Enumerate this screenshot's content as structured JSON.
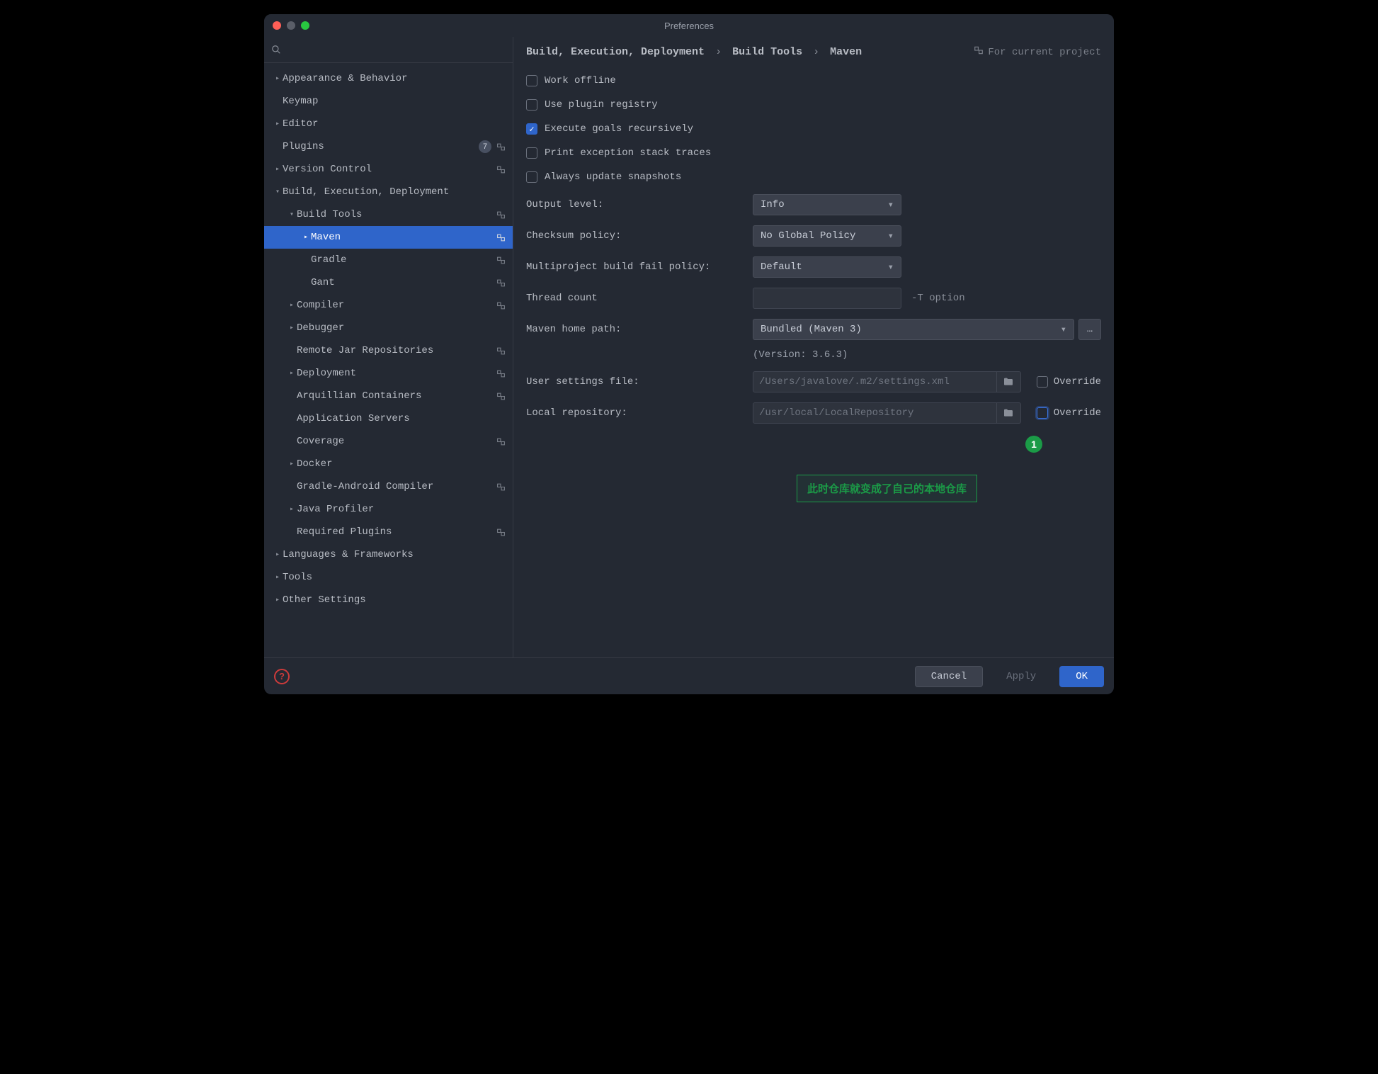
{
  "window": {
    "title": "Preferences"
  },
  "search": {
    "placeholder": ""
  },
  "sidebar": {
    "items": [
      {
        "label": "Appearance & Behavior",
        "indent": 0,
        "arrow": ">",
        "pin": false
      },
      {
        "label": "Keymap",
        "indent": 0,
        "arrow": "",
        "pin": false
      },
      {
        "label": "Editor",
        "indent": 0,
        "arrow": ">",
        "pin": false
      },
      {
        "label": "Plugins",
        "indent": 0,
        "arrow": "",
        "pin": true,
        "badge": "7"
      },
      {
        "label": "Version Control",
        "indent": 0,
        "arrow": ">",
        "pin": true
      },
      {
        "label": "Build, Execution, Deployment",
        "indent": 0,
        "arrow": "v",
        "pin": false
      },
      {
        "label": "Build Tools",
        "indent": 1,
        "arrow": "v",
        "pin": true
      },
      {
        "label": "Maven",
        "indent": 2,
        "arrow": ">",
        "pin": true,
        "selected": true
      },
      {
        "label": "Gradle",
        "indent": 2,
        "arrow": "",
        "pin": true
      },
      {
        "label": "Gant",
        "indent": 2,
        "arrow": "",
        "pin": true
      },
      {
        "label": "Compiler",
        "indent": 1,
        "arrow": ">",
        "pin": true
      },
      {
        "label": "Debugger",
        "indent": 1,
        "arrow": ">",
        "pin": false
      },
      {
        "label": "Remote Jar Repositories",
        "indent": 1,
        "arrow": "",
        "pin": true
      },
      {
        "label": "Deployment",
        "indent": 1,
        "arrow": ">",
        "pin": true
      },
      {
        "label": "Arquillian Containers",
        "indent": 1,
        "arrow": "",
        "pin": true
      },
      {
        "label": "Application Servers",
        "indent": 1,
        "arrow": "",
        "pin": false
      },
      {
        "label": "Coverage",
        "indent": 1,
        "arrow": "",
        "pin": true
      },
      {
        "label": "Docker",
        "indent": 1,
        "arrow": ">",
        "pin": false
      },
      {
        "label": "Gradle-Android Compiler",
        "indent": 1,
        "arrow": "",
        "pin": true
      },
      {
        "label": "Java Profiler",
        "indent": 1,
        "arrow": ">",
        "pin": false
      },
      {
        "label": "Required Plugins",
        "indent": 1,
        "arrow": "",
        "pin": true
      },
      {
        "label": "Languages & Frameworks",
        "indent": 0,
        "arrow": ">",
        "pin": false
      },
      {
        "label": "Tools",
        "indent": 0,
        "arrow": ">",
        "pin": false
      },
      {
        "label": "Other Settings",
        "indent": 0,
        "arrow": ">",
        "pin": false
      }
    ]
  },
  "breadcrumb": {
    "part1": "Build, Execution, Deployment",
    "part2": "Build Tools",
    "part3": "Maven"
  },
  "scope": "For current project",
  "checkboxes": {
    "workOffline": {
      "label": "Work offline",
      "checked": false
    },
    "pluginRegistry": {
      "label": "Use plugin registry",
      "checked": false
    },
    "execRecursive": {
      "label": "Execute goals recursively",
      "checked": true
    },
    "printException": {
      "label": "Print exception stack traces",
      "checked": false
    },
    "alwaysUpdate": {
      "label": "Always update snapshots",
      "checked": false
    }
  },
  "fields": {
    "outputLevel": {
      "label": "Output level:",
      "value": "Info"
    },
    "checksumPolicy": {
      "label": "Checksum policy:",
      "value": "No Global Policy"
    },
    "multiprojectFail": {
      "label": "Multiproject build fail policy:",
      "value": "Default"
    },
    "threadCount": {
      "label": "Thread count",
      "value": "",
      "hint": "-T option"
    },
    "mavenHome": {
      "label": "Maven home path:",
      "value": "Bundled (Maven 3)"
    },
    "versionNote": "(Version: 3.6.3)",
    "userSettings": {
      "label": "User settings file:",
      "value": "/Users/javalove/.m2/settings.xml",
      "override": "Override"
    },
    "localRepo": {
      "label": "Local repository:",
      "value": "/usr/local/LocalRepository",
      "override": "Override"
    }
  },
  "annotation": {
    "num": "1",
    "text": "此时仓库就变成了自己的本地仓库"
  },
  "footer": {
    "cancel": "Cancel",
    "apply": "Apply",
    "ok": "OK"
  }
}
